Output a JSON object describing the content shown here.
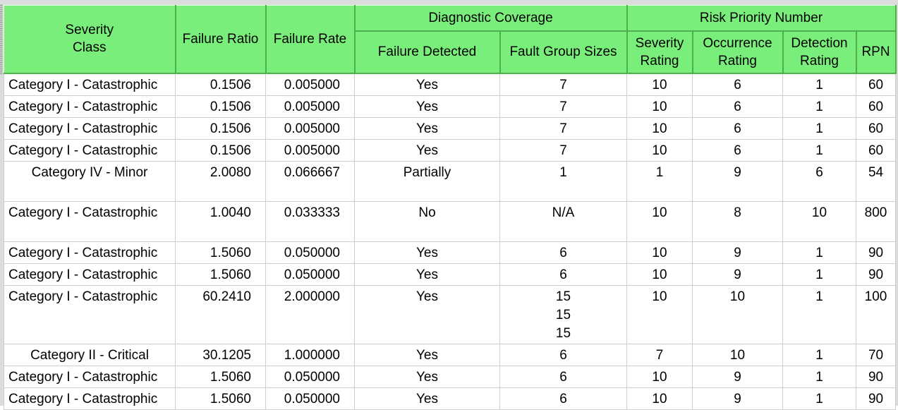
{
  "headers": {
    "severity_class": "Severity\nClass",
    "failure_ratio": "Failure Ratio",
    "failure_rate": "Failure Rate",
    "diagnostic_coverage": "Diagnostic Coverage",
    "failure_detected": "Failure Detected",
    "fault_group_sizes": "Fault Group Sizes",
    "risk_priority_number": "Risk Priority Number",
    "severity_rating": "Severity\nRating",
    "occurrence_rating": "Occurrence\nRating",
    "detection_rating": "Detection\nRating",
    "rpn": "RPN"
  },
  "rows": [
    {
      "severity": "Category I - Catastrophic",
      "ratio": "0.1506",
      "rate": "0.005000",
      "detected": "Yes",
      "groups": [
        "7"
      ],
      "sev_rating": "10",
      "occ_rating": "6",
      "det_rating": "1",
      "rpn": "60"
    },
    {
      "severity": "Category I - Catastrophic",
      "ratio": "0.1506",
      "rate": "0.005000",
      "detected": "Yes",
      "groups": [
        "7"
      ],
      "sev_rating": "10",
      "occ_rating": "6",
      "det_rating": "1",
      "rpn": "60"
    },
    {
      "severity": "Category I - Catastrophic",
      "ratio": "0.1506",
      "rate": "0.005000",
      "detected": "Yes",
      "groups": [
        "7"
      ],
      "sev_rating": "10",
      "occ_rating": "6",
      "det_rating": "1",
      "rpn": "60"
    },
    {
      "severity": "Category I - Catastrophic",
      "ratio": "0.1506",
      "rate": "0.005000",
      "detected": "Yes",
      "groups": [
        "7"
      ],
      "sev_rating": "10",
      "occ_rating": "6",
      "det_rating": "1",
      "rpn": "60"
    },
    {
      "severity": "Category IV - Minor",
      "ratio": "2.0080",
      "rate": "0.066667",
      "detected": "Partially",
      "groups": [
        "1"
      ],
      "sev_rating": "1",
      "occ_rating": "9",
      "det_rating": "6",
      "rpn": "54"
    },
    {
      "severity": "Category I - Catastrophic",
      "ratio": "1.0040",
      "rate": "0.033333",
      "detected": "No",
      "groups": [
        "N/A"
      ],
      "sev_rating": "10",
      "occ_rating": "8",
      "det_rating": "10",
      "rpn": "800"
    },
    {
      "severity": "Category I - Catastrophic",
      "ratio": "1.5060",
      "rate": "0.050000",
      "detected": "Yes",
      "groups": [
        "6"
      ],
      "sev_rating": "10",
      "occ_rating": "9",
      "det_rating": "1",
      "rpn": "90"
    },
    {
      "severity": "Category I - Catastrophic",
      "ratio": "1.5060",
      "rate": "0.050000",
      "detected": "Yes",
      "groups": [
        "6"
      ],
      "sev_rating": "10",
      "occ_rating": "9",
      "det_rating": "1",
      "rpn": "90"
    },
    {
      "severity": "Category I - Catastrophic",
      "ratio": "60.2410",
      "rate": "2.000000",
      "detected": "Yes",
      "groups": [
        "15",
        "15",
        "15"
      ],
      "sev_rating": "10",
      "occ_rating": "10",
      "det_rating": "1",
      "rpn": "100"
    },
    {
      "severity": "Category II - Critical",
      "ratio": "30.1205",
      "rate": "1.000000",
      "detected": "Yes",
      "groups": [
        "6"
      ],
      "sev_rating": "7",
      "occ_rating": "10",
      "det_rating": "1",
      "rpn": "70"
    },
    {
      "severity": "Category I - Catastrophic",
      "ratio": "1.5060",
      "rate": "0.050000",
      "detected": "Yes",
      "groups": [
        "6"
      ],
      "sev_rating": "10",
      "occ_rating": "9",
      "det_rating": "1",
      "rpn": "90"
    },
    {
      "severity": "Category I - Catastrophic",
      "ratio": "1.5060",
      "rate": "0.050000",
      "detected": "Yes",
      "groups": [
        "6"
      ],
      "sev_rating": "10",
      "occ_rating": "9",
      "det_rating": "1",
      "rpn": "90"
    }
  ],
  "colors": {
    "header_green": "#7aee7a",
    "cell_background": "#ffffff",
    "grid_line": "#cfcfcf"
  }
}
